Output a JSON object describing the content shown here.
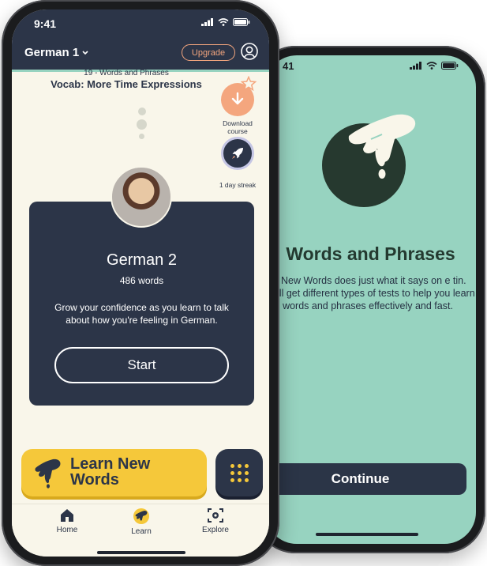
{
  "back_screen": {
    "time": "41",
    "title": "Words and Phrases",
    "description": "rn New Words does just what it says on e tin. You'll get different types of tests to help you learn words and phrases effectively and fast.",
    "continue_label": "Continue",
    "icons": [
      "signal-icon",
      "wifi-icon",
      "battery-icon",
      "hand-pinch-icon"
    ]
  },
  "front_screen": {
    "time": "9:41",
    "course_selector": "German 1",
    "upgrade_label": "Upgrade",
    "lesson": {
      "subtitle": "19 - Words and Phrases",
      "title": "Vocab: More Time Expressions"
    },
    "side_actions": {
      "download_label": "Download course",
      "streak_label": "1 day streak"
    },
    "card": {
      "title": "German 2",
      "count": "486 words",
      "description": "Grow your confidence as you learn to talk about how you're feeling in German.",
      "start_label": "Start"
    },
    "learn_button_label": "Learn New Words",
    "nav": {
      "home": "Home",
      "learn": "Learn",
      "explore": "Explore"
    },
    "colors": {
      "navy": "#2c3548",
      "cream": "#f9f6ea",
      "peach": "#f4a67e",
      "mint": "#97d3c0",
      "yellow": "#f5c83a"
    }
  }
}
